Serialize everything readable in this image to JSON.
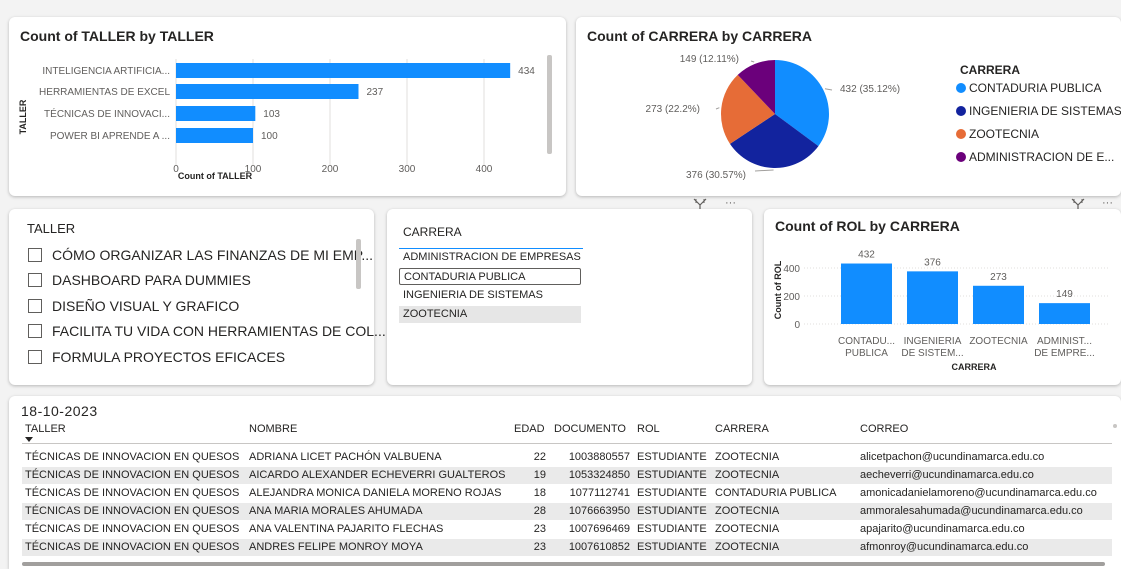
{
  "charts": {
    "taller_bar": {
      "title": "Count of TALLER by TALLER",
      "chart_data": {
        "type": "bar",
        "orientation": "horizontal",
        "categories": [
          "INTELIGENCIA ARTIFICIA...",
          "HERRAMIENTAS DE EXCEL",
          "TÉCNICAS DE INNOVACI...",
          "POWER BI APRENDE A ..."
        ],
        "values": [
          434,
          237,
          103,
          100
        ],
        "xlabel": "Count of TALLER",
        "ylabel": "TALLER",
        "xlim": [
          0,
          480
        ],
        "xticks": [
          "0",
          "100",
          "200",
          "300",
          "400"
        ],
        "color": "#118dff"
      }
    },
    "carrera_pie": {
      "title": "Count of CARRERA by CARRERA",
      "legend_title": "CARRERA",
      "chart_data": {
        "type": "pie",
        "labels": [
          "CONTADURIA PUBLICA",
          "INGENIERIA DE SISTEMAS",
          "ZOOTECNIA",
          "ADMINISTRACION DE E..."
        ],
        "values": [
          432,
          376,
          273,
          149
        ],
        "data_labels": [
          "432 (35.12%)",
          "376 (30.57%)",
          "273 (22.2%)",
          "149 (12.11%)"
        ],
        "colors": [
          "#118dff",
          "#12239e",
          "#e66c37",
          "#6b007b"
        ],
        "legend": "right"
      }
    },
    "rol_bar": {
      "title": "Count of ROL by CARRERA",
      "chart_data": {
        "type": "bar",
        "categories": [
          [
            "CONTADU...",
            "PUBLICA"
          ],
          [
            "INGENIERIA",
            "DE SISTEM..."
          ],
          [
            "ZOOTECNIA",
            ""
          ],
          [
            "ADMINIST...",
            "DE EMPRE..."
          ]
        ],
        "values": [
          432,
          376,
          273,
          149
        ],
        "xlabel": "CARRERA",
        "ylabel": "Count of ROL",
        "ylim": [
          0,
          480
        ],
        "yticks": [
          "0",
          "200",
          "400"
        ],
        "color": "#118dff"
      }
    }
  },
  "taller_slicer": {
    "title": "TALLER",
    "items": [
      "CÓMO ORGANIZAR LAS FINANZAS DE MI EMP...",
      "DASHBOARD PARA DUMMIES",
      "DISEÑO VISUAL Y GRAFICO",
      "FACILITA TU VIDA CON HERRAMIENTAS DE COL...",
      "FORMULA PROYECTOS EFICACES"
    ]
  },
  "carrera_slicer": {
    "title": "CARRERA",
    "items": [
      "ADMINISTRACION DE EMPRESAS",
      "CONTADURIA PUBLICA",
      "INGENIERIA DE SISTEMAS",
      "ZOOTECNIA"
    ]
  },
  "table": {
    "date": "18-10-2023",
    "headers": [
      "TALLER",
      "NOMBRE",
      "EDAD",
      "DOCUMENTO",
      "ROL",
      "CARRERA",
      "CORREO"
    ],
    "rows": [
      [
        "TÉCNICAS DE INNOVACION EN QUESOS",
        "ADRIANA LICET PACHÓN VALBUENA",
        "22",
        "1003880557",
        "ESTUDIANTE",
        "ZOOTECNIA",
        "alicetpachon@ucundinamarca.edu.co"
      ],
      [
        "TÉCNICAS DE INNOVACION EN QUESOS",
        "AICARDO ALEXANDER ECHEVERRI GUALTEROS",
        "19",
        "1053324850",
        "ESTUDIANTE",
        "ZOOTECNIA",
        "aecheverri@ucundinamarca.edu.co"
      ],
      [
        "TÉCNICAS DE INNOVACION EN QUESOS",
        "ALEJANDRA MONICA DANIELA MORENO ROJAS",
        "18",
        "1077112741",
        "ESTUDIANTE",
        "CONTADURIA PUBLICA",
        "amonicadanielamoreno@ucundinamarca.edu.co"
      ],
      [
        "TÉCNICAS DE INNOVACION EN QUESOS",
        "ANA MARIA MORALES AHUMADA",
        "28",
        "1076663950",
        "ESTUDIANTE",
        "ZOOTECNIA",
        "ammoralesahumada@ucundinamarca.edu.co"
      ],
      [
        "TÉCNICAS DE INNOVACION EN QUESOS",
        "ANA VALENTINA PAJARITO FLECHAS",
        "23",
        "1007696469",
        "ESTUDIANTE",
        "ZOOTECNIA",
        "apajarito@ucundinamarca.edu.co"
      ],
      [
        "TÉCNICAS DE INNOVACION EN QUESOS",
        "ANDRES FELIPE MONROY MOYA",
        "23",
        "1007610852",
        "ESTUDIANTE",
        "ZOOTECNIA",
        "afmonroy@ucundinamarca.edu.co"
      ]
    ]
  },
  "icons": {
    "filter": "filter-icon",
    "more": "more-options-icon",
    "sort": "sort-descending-icon"
  },
  "glyphs": {
    "more": "···"
  }
}
